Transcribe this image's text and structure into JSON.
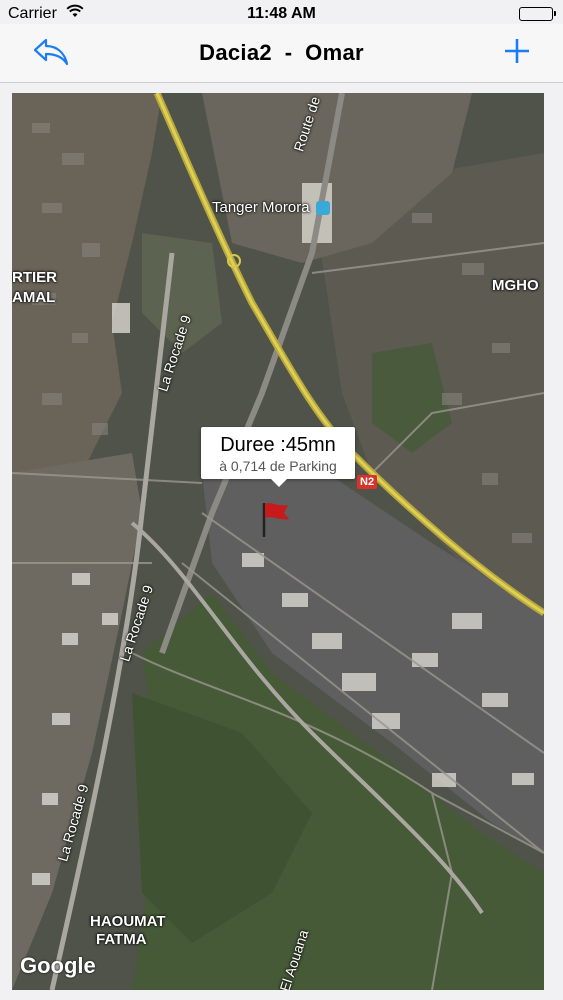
{
  "status_bar": {
    "carrier": "Carrier",
    "time": "11:48 AM"
  },
  "nav": {
    "title": "Dacia2  -  Omar",
    "back_icon": "back-reply-icon",
    "add_icon": "plus-icon",
    "accent": "#1a7ef2"
  },
  "map": {
    "labels": {
      "station": "Tanger Morora",
      "quartier_1": "RTIER",
      "quartier_2": "AMAL",
      "mgho": "MGHO",
      "haoumat_1": "HAOUMAT",
      "haoumat_2": "FATMA",
      "route": "Route de",
      "rocade_1": "La Rocade 9",
      "rocade_2": "La Rocade 9",
      "rocade_3": "La Rocade 9",
      "aouana": "El Aouana",
      "n2": "N2"
    },
    "callout": {
      "title": "Duree :45mn",
      "subtitle": "à 0,714 de Parking"
    },
    "attribution": "Google"
  }
}
